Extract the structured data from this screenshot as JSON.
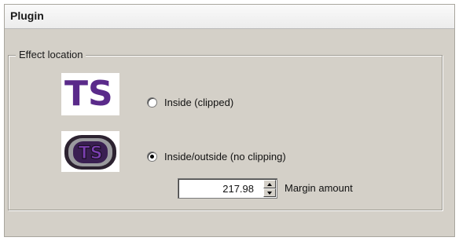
{
  "window": {
    "title": "Plugin"
  },
  "effect_location": {
    "group_label": "Effect location",
    "icons": {
      "clipped_icon": "ts-flat-purple-icon",
      "clipped_icon_text": "TS",
      "no_clipping_icon": "ts-outlined-purple-icon",
      "no_clipping_icon_text": "TS"
    },
    "options": [
      {
        "label": "Inside (clipped)",
        "selected": false
      },
      {
        "label": "Inside/outside (no clipping)",
        "selected": true
      }
    ],
    "margin": {
      "value": "217.98",
      "label": "Margin amount"
    }
  },
  "colors": {
    "panel": "#d4d0c8",
    "icon_purple": "#5a2a8a"
  }
}
